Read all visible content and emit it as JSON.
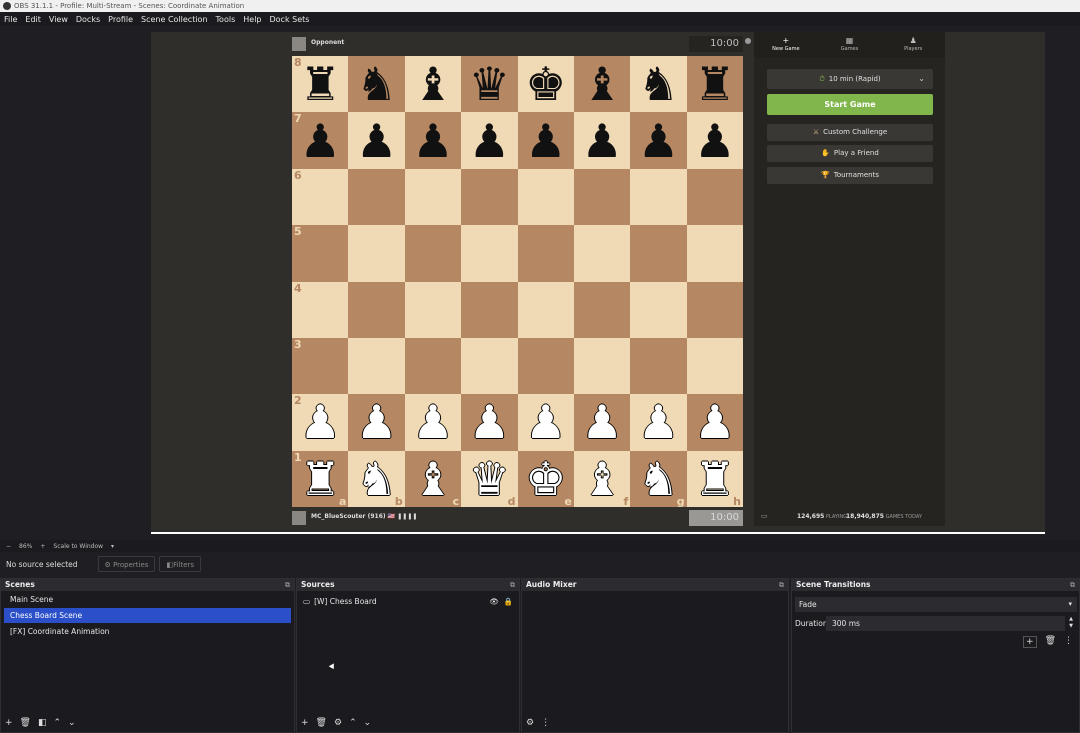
{
  "window": {
    "title": "OBS 31.1.1 - Profile: Multi-Stream - Scenes: Coordinate Animation"
  },
  "menu": [
    "File",
    "Edit",
    "View",
    "Docks",
    "Profile",
    "Scene Collection",
    "Tools",
    "Help",
    "Dock Sets"
  ],
  "chess": {
    "opponent_name": "Opponent",
    "opponent_clock": "10:00",
    "player_name": "MC_BlueScouter (916) 🇺🇸 ❚❚❚❚",
    "player_clock": "10:00",
    "ranks": [
      "8",
      "7",
      "6",
      "5",
      "4",
      "3",
      "2",
      "1"
    ],
    "files": [
      "a",
      "b",
      "c",
      "d",
      "e",
      "f",
      "g",
      "h"
    ],
    "board": [
      [
        "r",
        "n",
        "b",
        "q",
        "k",
        "b",
        "n",
        "r"
      ],
      [
        "p",
        "p",
        "p",
        "p",
        "p",
        "p",
        "p",
        "p"
      ],
      [
        "",
        "",
        "",
        "",
        "",
        "",
        "",
        ""
      ],
      [
        "",
        "",
        "",
        "",
        "",
        "",
        "",
        ""
      ],
      [
        "",
        "",
        "",
        "",
        "",
        "",
        "",
        ""
      ],
      [
        "",
        "",
        "",
        "",
        "",
        "",
        "",
        ""
      ],
      [
        "P",
        "P",
        "P",
        "P",
        "P",
        "P",
        "P",
        "P"
      ],
      [
        "R",
        "N",
        "B",
        "Q",
        "K",
        "B",
        "N",
        "R"
      ]
    ]
  },
  "panel": {
    "tabs": [
      {
        "label": "New Game",
        "icon": "plus-icon"
      },
      {
        "label": "Games",
        "icon": "grid-icon"
      },
      {
        "label": "Players",
        "icon": "players-icon"
      }
    ],
    "time_control": "10 min (Rapid)",
    "start_game": "Start Game",
    "custom_challenge": "Custom Challenge",
    "play_friend": "Play a Friend",
    "tournaments": "Tournaments",
    "playing_count": "124,695",
    "playing_label": "PLAYING",
    "games_count": "18,940,875",
    "games_label": "GAMES TODAY"
  },
  "zoom": {
    "level": "86%",
    "mode": "Scale to Window"
  },
  "properties_bar": {
    "no_selection": "No source selected",
    "properties": "Properties",
    "filters": "Filters"
  },
  "docks": {
    "scenes": {
      "title": "Scenes",
      "items": [
        "Main Scene",
        "Chess Board Scene",
        "[FX] Coordinate Animation"
      ],
      "selected": 1
    },
    "sources": {
      "title": "Sources",
      "items": [
        "[W] Chess Board"
      ]
    },
    "mixer": {
      "title": "Audio Mixer"
    },
    "transitions": {
      "title": "Scene Transitions",
      "type": "Fade",
      "duration_label": "Duration",
      "duration_value": "300 ms"
    }
  }
}
